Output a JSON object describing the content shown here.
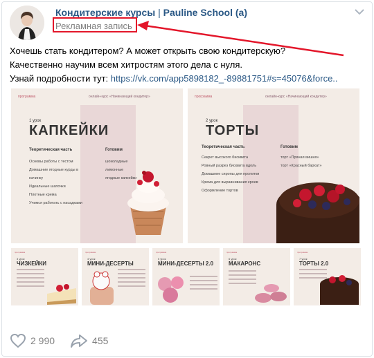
{
  "post": {
    "author_name": "Кондитерские курсы",
    "author_sep": " | ",
    "author_school": "Pauline School (a)",
    "ad_label": "Рекламная запись",
    "text_line1": "Хочешь стать кондитером? А может открыть свою кондитерскую?",
    "text_line2": "Качественно научим всем хитростям этого дела с нуля.",
    "text_line3_prefix": "Узнай подробности тут: ",
    "text_link": "https://vk.com/app5898182_-89881751#s=45076&force..",
    "likes": "2 990",
    "shares": "455"
  },
  "slides": {
    "program_label": "программа",
    "course_label": "онлайн-курс «Начинающий кондитер»",
    "main": [
      {
        "lesson": "1 урок",
        "title": "КАПКЕЙКИ",
        "theory_header": "Теоретическая часть",
        "ready_header": "Готовим",
        "theory": [
          "Основы работы с тестом",
          "Домашние ягодные курды в начинку",
          "Идеальные шапочки",
          "Плотные крема",
          "Учимся работать с насадками"
        ],
        "ready": [
          "шоколадные",
          "лимонные",
          "ягодные капкейки"
        ]
      },
      {
        "lesson": "2 урок",
        "title": "ТОРТЫ",
        "theory_header": "Теоретическая часть",
        "ready_header": "Готовим",
        "theory": [
          "Секрет высокого бисквита",
          "Ровный разрез бисквита вдоль",
          "Домашние сиропы для пропитки",
          "Крема для выравнивания кроев",
          "Оформление тортов"
        ],
        "ready": [
          "торт «Пряная вишня»",
          "торт «Красный бархат»"
        ]
      }
    ],
    "small": [
      {
        "lesson": "3 урок",
        "title": "ЧИЗКЕЙКИ"
      },
      {
        "lesson": "4 урок",
        "title": "МИНИ-ДЕСЕРТЫ"
      },
      {
        "lesson": "5 урок",
        "title": "МИНИ-ДЕСЕРТЫ 2.0"
      },
      {
        "lesson": "6 урок",
        "title": "МАКАРОНС"
      },
      {
        "lesson": "7 урок",
        "title": "ТОРТЫ 2.0"
      }
    ]
  },
  "colors": {
    "link": "#2a5885",
    "annotation_red": "#e3162a",
    "muted": "#828282"
  }
}
